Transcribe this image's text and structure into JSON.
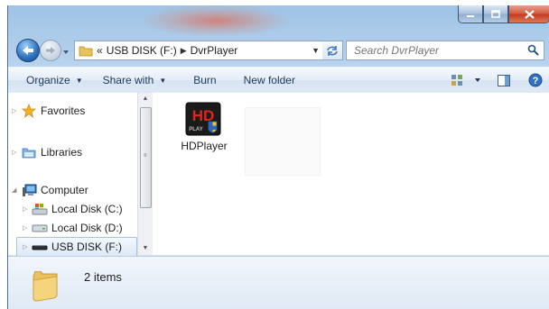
{
  "window": {
    "caption_buttons": [
      "minimize-icon",
      "maximize-icon",
      "close-icon"
    ]
  },
  "navigation": {
    "address_parts": [
      "«",
      "USB DISK (F:)",
      "DvrPlayer"
    ],
    "search_placeholder": "Search DvrPlayer"
  },
  "toolbar": {
    "organize": "Organize",
    "share_with": "Share with",
    "burn": "Burn",
    "new_folder": "New folder"
  },
  "nav_pane": {
    "favorites": "Favorites",
    "libraries": "Libraries",
    "computer": "Computer",
    "local_c": "Local Disk (C:)",
    "local_d": "Local Disk (D:)",
    "usb": "USB DISK (F:)"
  },
  "files": [
    {
      "name": "HDPlayer",
      "icon": "hdplayer-app-icon"
    }
  ],
  "details": {
    "count": "2 items"
  },
  "colors": {
    "accent": "#2c6fbd",
    "toolbar_text": "#1e395b",
    "selection_border": "#a5c3e6"
  }
}
